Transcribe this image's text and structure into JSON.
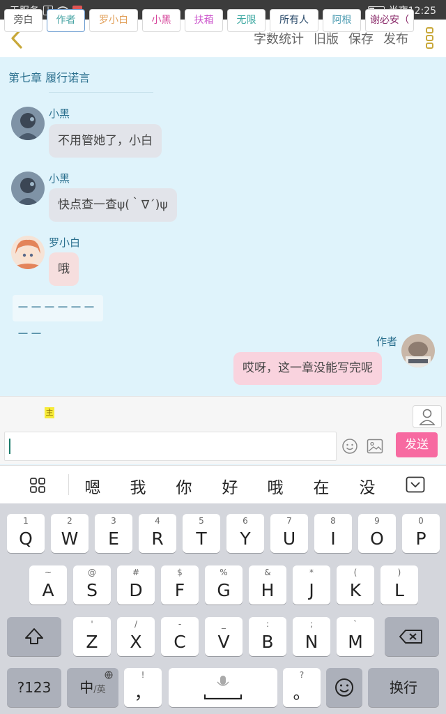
{
  "status_bar": {
    "carrier": "无服务",
    "time": "半夜12:25"
  },
  "toolbar": {
    "actions": [
      "字数统计",
      "旧版",
      "保存",
      "发布"
    ],
    "accent_color": "#c8a83a"
  },
  "chapter": {
    "title": "第七章  履行诺言"
  },
  "messages": [
    {
      "name": "小黑",
      "text": "不用管她了，小白"
    },
    {
      "name": "小黑",
      "text": "快点查一查ψ(｀∇´)ψ"
    },
    {
      "name": "罗小白",
      "text": "哦"
    },
    {
      "divider": "－－－－－－－－"
    },
    {
      "name": "作者",
      "text": "哎呀，这一章没能写完呢"
    }
  ],
  "characters": {
    "owner_tag": "主",
    "chips": [
      {
        "label": "旁白",
        "color": "#555555"
      },
      {
        "label": "作者",
        "color": "#4aa5a5"
      },
      {
        "label": "罗小白",
        "color": "#e2a05a"
      },
      {
        "label": "小黑",
        "color": "#d6449a"
      },
      {
        "label": "扶葙",
        "color": "#cc55cc"
      },
      {
        "label": "无限",
        "color": "#3aa7a0"
      },
      {
        "label": "所有人",
        "color": "#2a4a6a"
      },
      {
        "label": "阿根",
        "color": "#4a9ab0"
      },
      {
        "label": "谢必安（",
        "color": "#8a2a6a"
      }
    ]
  },
  "input": {
    "value": "",
    "send_label": "发送",
    "send_color": "#f76aa1"
  },
  "ime": {
    "candidates": [
      "嗯",
      "我",
      "你",
      "好",
      "哦",
      "在",
      "没"
    ]
  },
  "keyboard": {
    "row1": [
      {
        "hint": "1",
        "key": "Q"
      },
      {
        "hint": "2",
        "key": "W"
      },
      {
        "hint": "3",
        "key": "E"
      },
      {
        "hint": "4",
        "key": "R"
      },
      {
        "hint": "5",
        "key": "T"
      },
      {
        "hint": "6",
        "key": "Y"
      },
      {
        "hint": "7",
        "key": "U"
      },
      {
        "hint": "8",
        "key": "I"
      },
      {
        "hint": "9",
        "key": "O"
      },
      {
        "hint": "0",
        "key": "P"
      }
    ],
    "row2": [
      {
        "hint": "~",
        "key": "A"
      },
      {
        "hint": "@",
        "key": "S"
      },
      {
        "hint": "#",
        "key": "D"
      },
      {
        "hint": "$",
        "key": "F"
      },
      {
        "hint": "%",
        "key": "G"
      },
      {
        "hint": "&",
        "key": "H"
      },
      {
        "hint": "*",
        "key": "J"
      },
      {
        "hint": "(",
        "key": "K"
      },
      {
        "hint": ")",
        "key": "L"
      }
    ],
    "row3": [
      {
        "hint": "'",
        "key": "Z"
      },
      {
        "hint": "/",
        "key": "X"
      },
      {
        "hint": "-",
        "key": "C"
      },
      {
        "hint": "_",
        "key": "V"
      },
      {
        "hint": ":",
        "key": "B"
      },
      {
        "hint": ";",
        "key": "N"
      },
      {
        "hint": "`",
        "key": "M"
      }
    ],
    "numbers_key": "?123",
    "lang_key": "中",
    "lang_sub": "/英",
    "comma_hint": "!",
    "comma_key": "，",
    "period_hint": "?",
    "period_key": "。",
    "enter_key": "换行"
  }
}
